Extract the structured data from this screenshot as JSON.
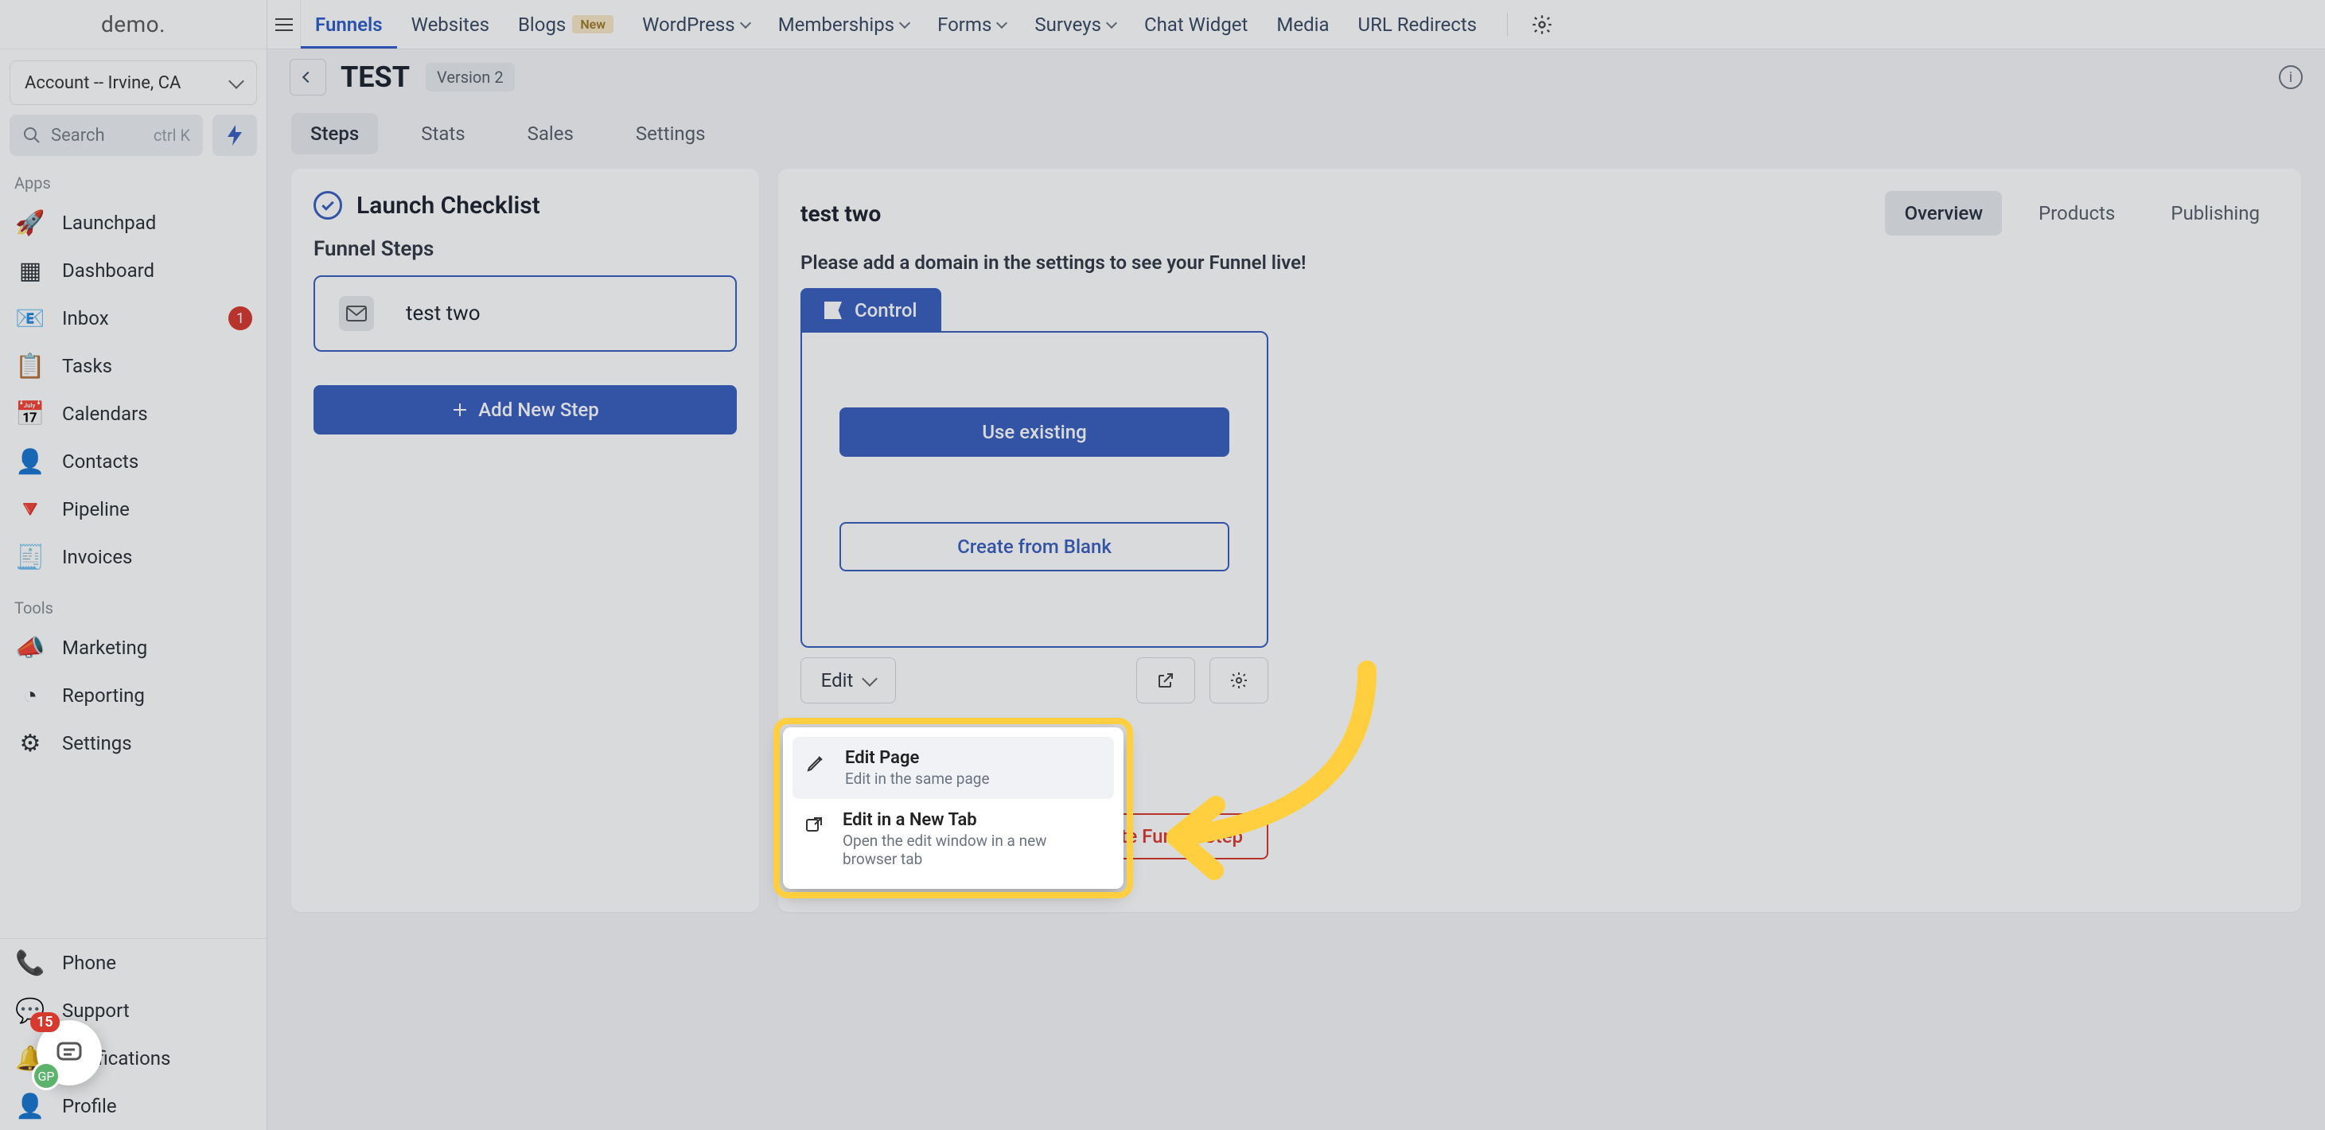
{
  "brand": "demo.",
  "account_selector": {
    "label": "Account -- Irvine, CA"
  },
  "search": {
    "label": "Search",
    "shortcut": "ctrl K"
  },
  "section_titles": {
    "apps": "Apps",
    "tools": "Tools"
  },
  "sidebar": {
    "apps": [
      {
        "icon": "🚀",
        "label": "Launchpad"
      },
      {
        "icon": "▦",
        "label": "Dashboard"
      },
      {
        "icon": "📧",
        "label": "Inbox",
        "badge": "1"
      },
      {
        "icon": "📋",
        "label": "Tasks"
      },
      {
        "icon": "📅",
        "label": "Calendars"
      },
      {
        "icon": "👤",
        "label": "Contacts"
      },
      {
        "icon": "🔻",
        "label": "Pipeline"
      },
      {
        "icon": "🧾",
        "label": "Invoices"
      }
    ],
    "tools": [
      {
        "icon": "📣",
        "label": "Marketing"
      },
      {
        "icon": "◔",
        "label": "Reporting"
      },
      {
        "icon": "⚙",
        "label": "Settings"
      }
    ],
    "bottom": [
      {
        "icon": "📞",
        "label": "Phone"
      },
      {
        "icon": "💬",
        "label": "Support"
      },
      {
        "icon": "🔔",
        "label": "Notifications"
      },
      {
        "icon": "👤",
        "label": "Profile"
      }
    ]
  },
  "topnav": {
    "items": [
      {
        "label": "Funnels",
        "active": true
      },
      {
        "label": "Websites"
      },
      {
        "label": "Blogs",
        "pill": "New"
      },
      {
        "label": "WordPress",
        "chevron": true
      },
      {
        "label": "Memberships",
        "chevron": true
      },
      {
        "label": "Forms",
        "chevron": true
      },
      {
        "label": "Surveys",
        "chevron": true
      },
      {
        "label": "Chat Widget"
      },
      {
        "label": "Media"
      },
      {
        "label": "URL Redirects"
      }
    ]
  },
  "funnel": {
    "title": "TEST",
    "version": "Version 2",
    "tabs": [
      "Steps",
      "Stats",
      "Sales",
      "Settings"
    ],
    "active_tab": "Steps"
  },
  "steps_panel": {
    "launch_label": "Launch Checklist",
    "steps_heading": "Funnel Steps",
    "step_name": "test two",
    "add_step_label": "Add New Step"
  },
  "detail": {
    "title": "test two",
    "domain_warning": "Please add a domain in the settings to see your Funnel live!",
    "view_tabs": [
      "Overview",
      "Products",
      "Publishing"
    ],
    "active_view": "Overview",
    "control_label": "Control",
    "use_existing": "Use existing",
    "create_blank": "Create from Blank",
    "edit_label": "Edit",
    "delete_label": "Delete Funnel Step"
  },
  "edit_dropdown": {
    "items": [
      {
        "title": "Edit Page",
        "subtitle": "Edit in the same page"
      },
      {
        "title": "Edit in a New Tab",
        "subtitle": "Open the edit window in a new browser tab"
      }
    ]
  },
  "chat_badge": "15"
}
